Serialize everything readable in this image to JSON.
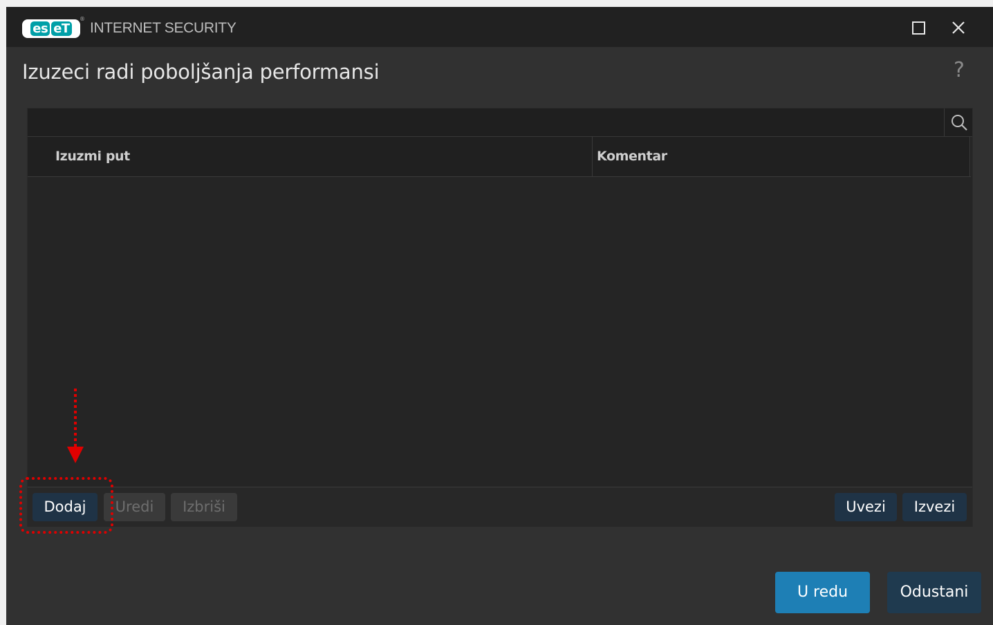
{
  "window": {
    "logo_letters": [
      "es",
      "eT"
    ],
    "product_name": "INTERNET SECURITY",
    "maximize_icon": "maximize-icon",
    "close_icon": "close-icon"
  },
  "dialog": {
    "title": "Izuzeci radi poboljšanja performansi",
    "help_label": "?"
  },
  "search": {
    "value": "",
    "placeholder": "",
    "icon": "search-icon"
  },
  "table": {
    "columns": [
      "Izuzmi put",
      "Komentar"
    ],
    "rows": []
  },
  "toolbar": {
    "add_label": "Dodaj",
    "edit_label": "Uredi",
    "delete_label": "Izbriši",
    "import_label": "Uvezi",
    "export_label": "Izvezi"
  },
  "footer": {
    "ok_label": "U redu",
    "cancel_label": "Odustani"
  },
  "colors": {
    "accent": "#1e7fb5",
    "button_dark": "#1f3346",
    "annotation": "#e00000",
    "background": "#313131"
  }
}
